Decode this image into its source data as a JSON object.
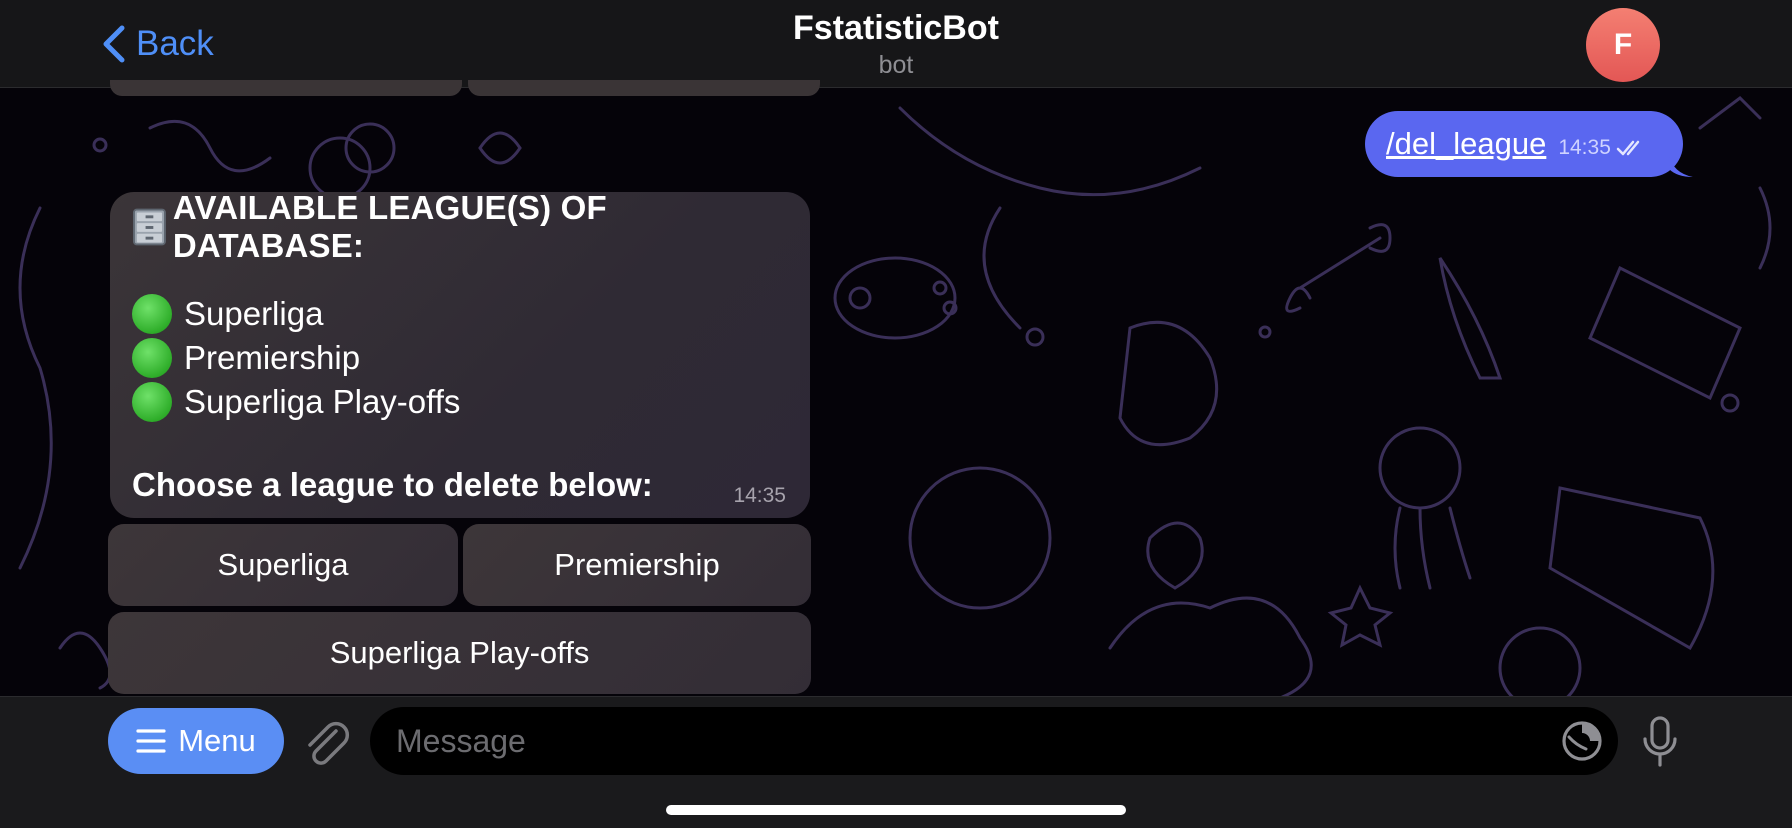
{
  "header": {
    "back_label": "Back",
    "title": "FstatisticBot",
    "subtitle": "bot",
    "avatar_letter": "F"
  },
  "outgoing_message": {
    "text": "/del_league",
    "time": "14:35",
    "status_icon": "double-check-icon"
  },
  "incoming_message": {
    "header_icon": "file-cabinet-icon",
    "header": "AVAILABLE LEAGUE(S) OF DATABASE:",
    "leagues": [
      {
        "icon": "green-circle-icon",
        "name": "Superliga"
      },
      {
        "icon": "green-circle-icon",
        "name": "Premiership"
      },
      {
        "icon": "green-circle-icon",
        "name": "Superliga Play-offs"
      }
    ],
    "prompt": "Choose a league to delete below:",
    "time": "14:35"
  },
  "keyboard": {
    "buttons": [
      "Superliga",
      "Premiership",
      "Superliga Play-offs"
    ]
  },
  "input_bar": {
    "menu_label": "Menu",
    "placeholder": "Message"
  },
  "colors": {
    "accent": "#5a8ef4",
    "outgoing_bubble": "#5a67f0",
    "incoming_bubble": "#38323a",
    "header_bg": "#161618"
  }
}
